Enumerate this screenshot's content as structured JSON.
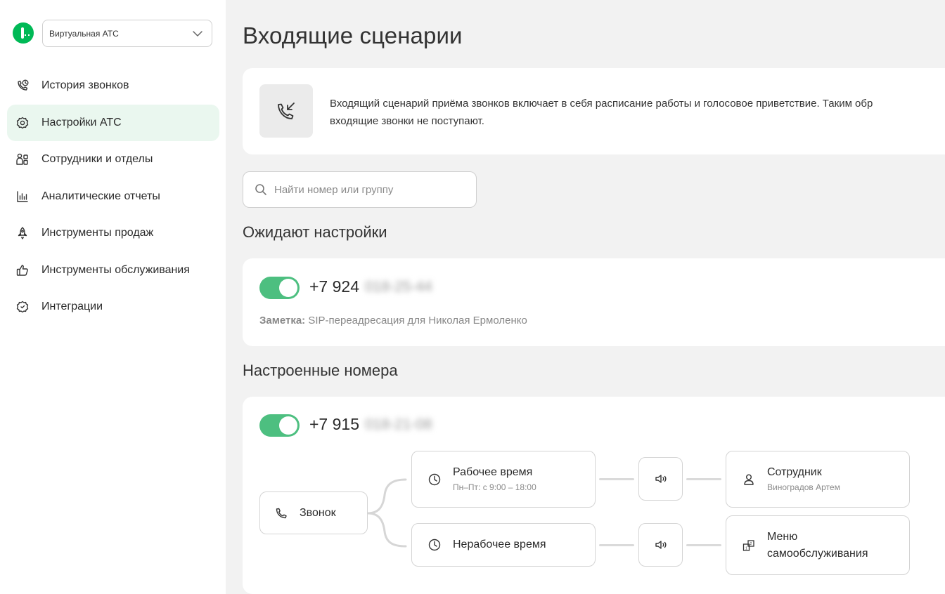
{
  "app": {
    "selector_value": "Виртуальная АТС",
    "logo": "megafon-logo"
  },
  "sidebar": {
    "items": [
      {
        "label": "История звонков",
        "icon": "call-history-icon",
        "active": false
      },
      {
        "label": "Настройки АТС",
        "icon": "gear-icon",
        "active": true
      },
      {
        "label": "Сотрудники и отделы",
        "icon": "people-icon",
        "active": false
      },
      {
        "label": "Аналитические отчеты",
        "icon": "bar-chart-icon",
        "active": false
      },
      {
        "label": "Инструменты продаж",
        "icon": "rocket-icon",
        "active": false
      },
      {
        "label": "Инструменты обслуживания",
        "icon": "thumbs-up-icon",
        "active": false
      },
      {
        "label": "Интеграции",
        "icon": "integration-gear-icon",
        "active": false
      }
    ]
  },
  "page": {
    "title": "Входящие сценарии",
    "info_line1": "Входящий сценарий приёма звонков включает в себя расписание работы и голосовое приветствие. Таким обр",
    "info_line2": "входящие звонки не поступают.",
    "search_placeholder": "Найти номер или группу"
  },
  "pending": {
    "title": "Ожидают настройки",
    "number_prefix": "+7 924",
    "number_hidden": "018-25-44",
    "enabled": true,
    "note_label": "Заметка:",
    "note_text": "SIP-переадресация для Николая Ермоленко"
  },
  "configured": {
    "title": "Настроенные номера",
    "number_prefix": "+7 915",
    "number_hidden": "018-21-08",
    "enabled": true,
    "flow": {
      "call": "Звонок",
      "work_time": "Рабочее время",
      "work_schedule": "Пн–Пт: с 9:00 – 18:00",
      "nonwork_time": "Нерабочее время",
      "employee_label": "Сотрудник",
      "employee_name": "Виноградов Артем",
      "menu_line1": "Меню",
      "menu_line2": "самообслуживания"
    }
  },
  "colors": {
    "accent": "#00b956",
    "toggle": "#4dbf80",
    "active_nav_bg": "#eaf7ef",
    "page_bg": "#f2f2f2"
  }
}
